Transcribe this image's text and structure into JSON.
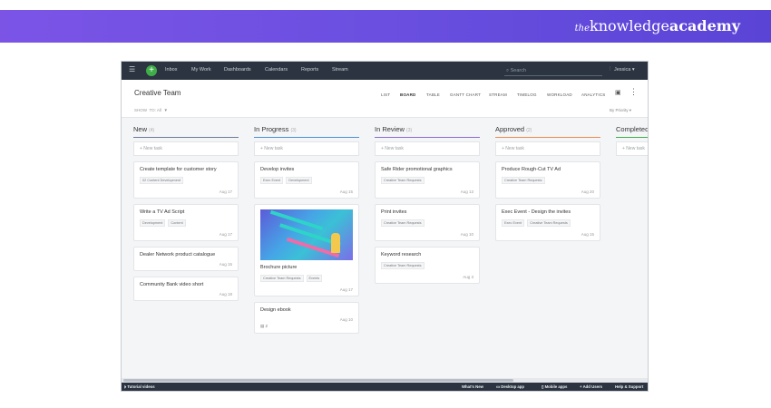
{
  "brand": {
    "the": "the",
    "knowledge": "knowledge",
    "academy": "academy"
  },
  "topnav": {
    "menu_icon": "hamburger-icon",
    "add_icon": "plus-icon",
    "items": [
      "Inbox",
      "My Work",
      "Dashboards",
      "Calendars",
      "Reports",
      "Stream"
    ],
    "search_placeholder": "Search",
    "user": "Jessica"
  },
  "project": {
    "title": "Creative Team",
    "views": [
      "LIST",
      "BOARD",
      "TABLE",
      "GANTT CHART",
      "STREAM",
      "TIMELOG",
      "WORKLOAD",
      "ANALYTICS"
    ],
    "active_view": "BOARD",
    "show": "SHOW",
    "filter_value": "TO: All",
    "sort": "By Priority"
  },
  "new_task_label": "+ New task",
  "columns": [
    {
      "name": "New",
      "count": "(4)",
      "color": "#6b7a99",
      "cards": [
        {
          "title": "Create template for customer story",
          "tags": [
            "02 Content Development"
          ],
          "date": "Aug 17"
        },
        {
          "title": "Write a TV Ad Script",
          "tags": [
            "Development",
            "Content"
          ],
          "date": "Aug 17"
        },
        {
          "title": "Dealer Network product catalogue",
          "tags": [],
          "date": "Aug 15"
        },
        {
          "title": "Community Bank video short",
          "tags": [],
          "date": "Aug 18"
        }
      ]
    },
    {
      "name": "In Progress",
      "count": "(3)",
      "color": "#4a90d9",
      "cards": [
        {
          "title": "Develop invites",
          "tags": [
            "Exec Event",
            "Development"
          ],
          "date": "Aug 15"
        },
        {
          "title": "Brochure picture",
          "tags": [
            "Creative Team Requests",
            "Events"
          ],
          "date": "Aug 17",
          "image": true
        },
        {
          "title": "Design ebook",
          "tags": [],
          "date": "Aug 10",
          "comments": "2"
        }
      ]
    },
    {
      "name": "In Review",
      "count": "(3)",
      "color": "#8a6bd1",
      "cards": [
        {
          "title": "Safe Rider promotional graphics",
          "tags": [
            "Creative Team Requests"
          ],
          "date": "Aug 13"
        },
        {
          "title": "Print invites",
          "tags": [
            "Creative Team Requests"
          ],
          "date": "Aug 10"
        },
        {
          "title": "Keyword research",
          "tags": [
            "Creative Team Requests"
          ],
          "date": "Aug 3"
        }
      ]
    },
    {
      "name": "Approved",
      "count": "(2)",
      "color": "#f28b50",
      "cards": [
        {
          "title": "Produce Rough-Cut TV Ad",
          "tags": [
            "Creative Team Requests"
          ],
          "date": "Aug 20"
        },
        {
          "title": "Exec Event - Design the invites",
          "tags": [
            "Exec Event",
            "Creative Team Requests"
          ],
          "date": "Aug 15"
        }
      ]
    },
    {
      "name": "Completed",
      "count": "",
      "color": "#3fae49",
      "cards": []
    }
  ],
  "footer": {
    "tutorial": "Tutorial videos",
    "whats_new": "What's New",
    "desktop": "Desktop app",
    "mobile": "Mobile apps",
    "add_users": "Add Users",
    "help": "Help & Support"
  }
}
